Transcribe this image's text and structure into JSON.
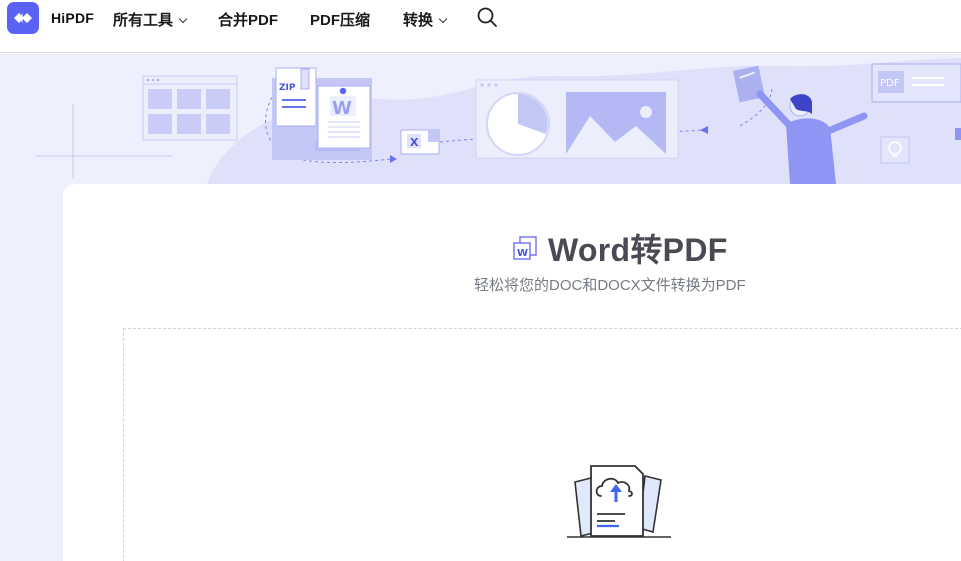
{
  "header": {
    "brand": "HiPDF",
    "nav": [
      {
        "label": "所有工具",
        "has_dropdown": true
      },
      {
        "label": "合并PDF",
        "has_dropdown": false
      },
      {
        "label": "PDF压缩",
        "has_dropdown": false
      },
      {
        "label": "转换",
        "has_dropdown": true
      }
    ],
    "search_icon": "search-icon"
  },
  "hero": {
    "badges": {
      "zip": "ZIP",
      "pdf": "PDF",
      "w": "W",
      "x": "X"
    }
  },
  "tool": {
    "title": "Word转PDF",
    "subtitle": "轻松将您的DOC和DOCX文件转换为PDF",
    "title_icon": "word-file-icon"
  },
  "upload": {
    "icon": "cloud-upload-document-icon"
  },
  "colors": {
    "accent": "#5b63f5",
    "hero_bg": "#eff0fd",
    "illustration": "#b9bdf7"
  }
}
